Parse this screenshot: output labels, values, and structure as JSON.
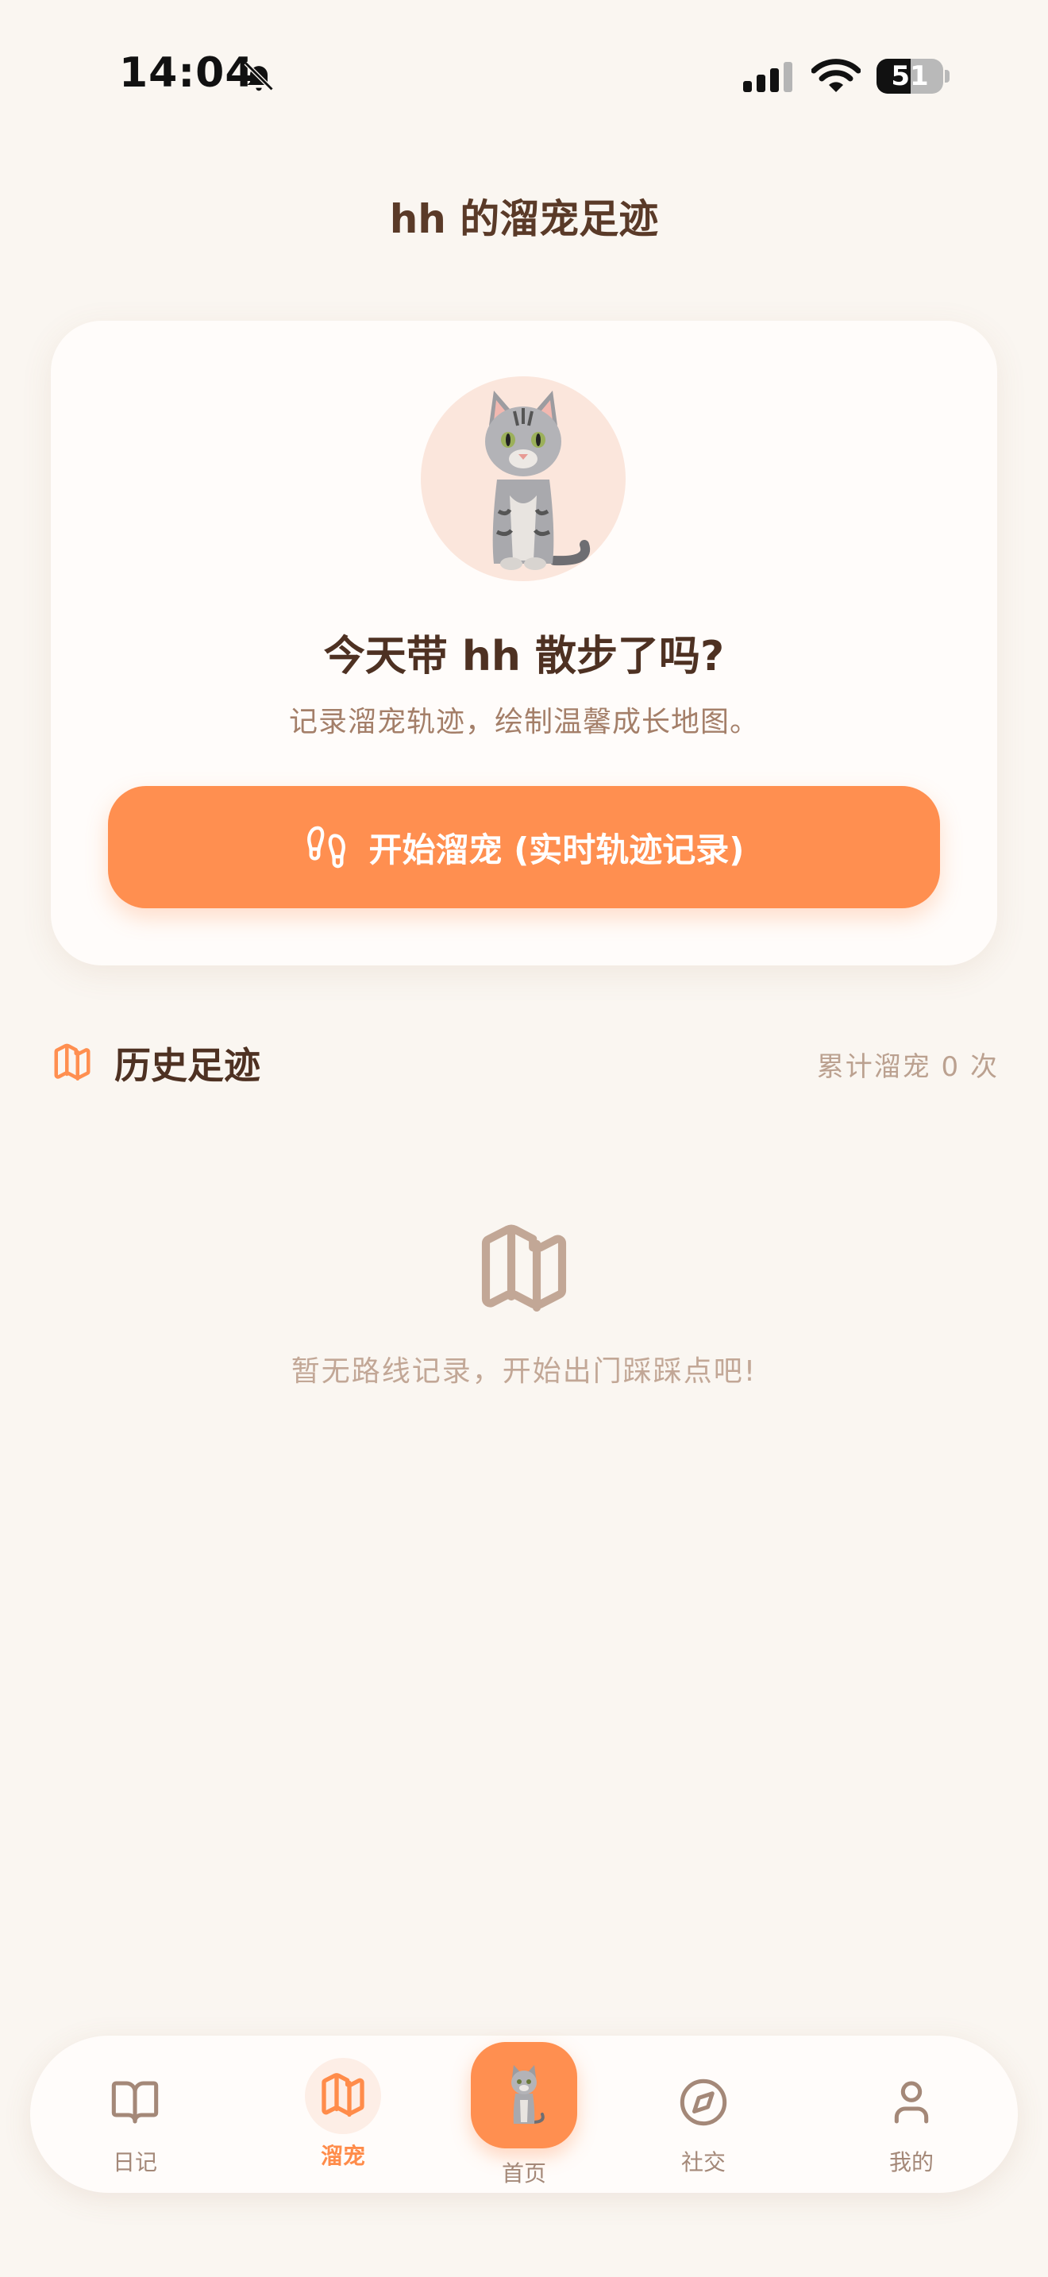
{
  "status_bar": {
    "time": "14:04",
    "battery": "51",
    "icons": [
      "bell-slash-icon",
      "cellular-signal-icon",
      "wifi-icon",
      "battery-icon"
    ]
  },
  "header": {
    "title": "hh 的溜宠足迹"
  },
  "hero": {
    "avatar": "cat-avatar",
    "question": "今天带 hh 散步了吗?",
    "subtitle": "记录溜宠轨迹，绘制温馨成长地图。",
    "start_button": "开始溜宠 (实时轨迹记录)",
    "start_icon": "footprints-icon"
  },
  "history": {
    "title": "历史足迹",
    "count_text": "累计溜宠 0 次",
    "empty_icon": "map-icon",
    "empty_text": "暂无路线记录，开始出门踩踩点吧!"
  },
  "tabbar": {
    "items": [
      {
        "label": "日记",
        "icon": "book-open-icon",
        "active": false
      },
      {
        "label": "溜宠",
        "icon": "map-icon",
        "active": true
      },
      {
        "label": "首页",
        "icon": "cat-icon",
        "active": false
      },
      {
        "label": "社交",
        "icon": "compass-icon",
        "active": false
      },
      {
        "label": "我的",
        "icon": "user-icon",
        "active": false
      }
    ]
  },
  "colors": {
    "background": "#faf6f1",
    "accent": "#ff8f50",
    "title_text": "#5a3a28",
    "muted_text": "#a47f69"
  }
}
